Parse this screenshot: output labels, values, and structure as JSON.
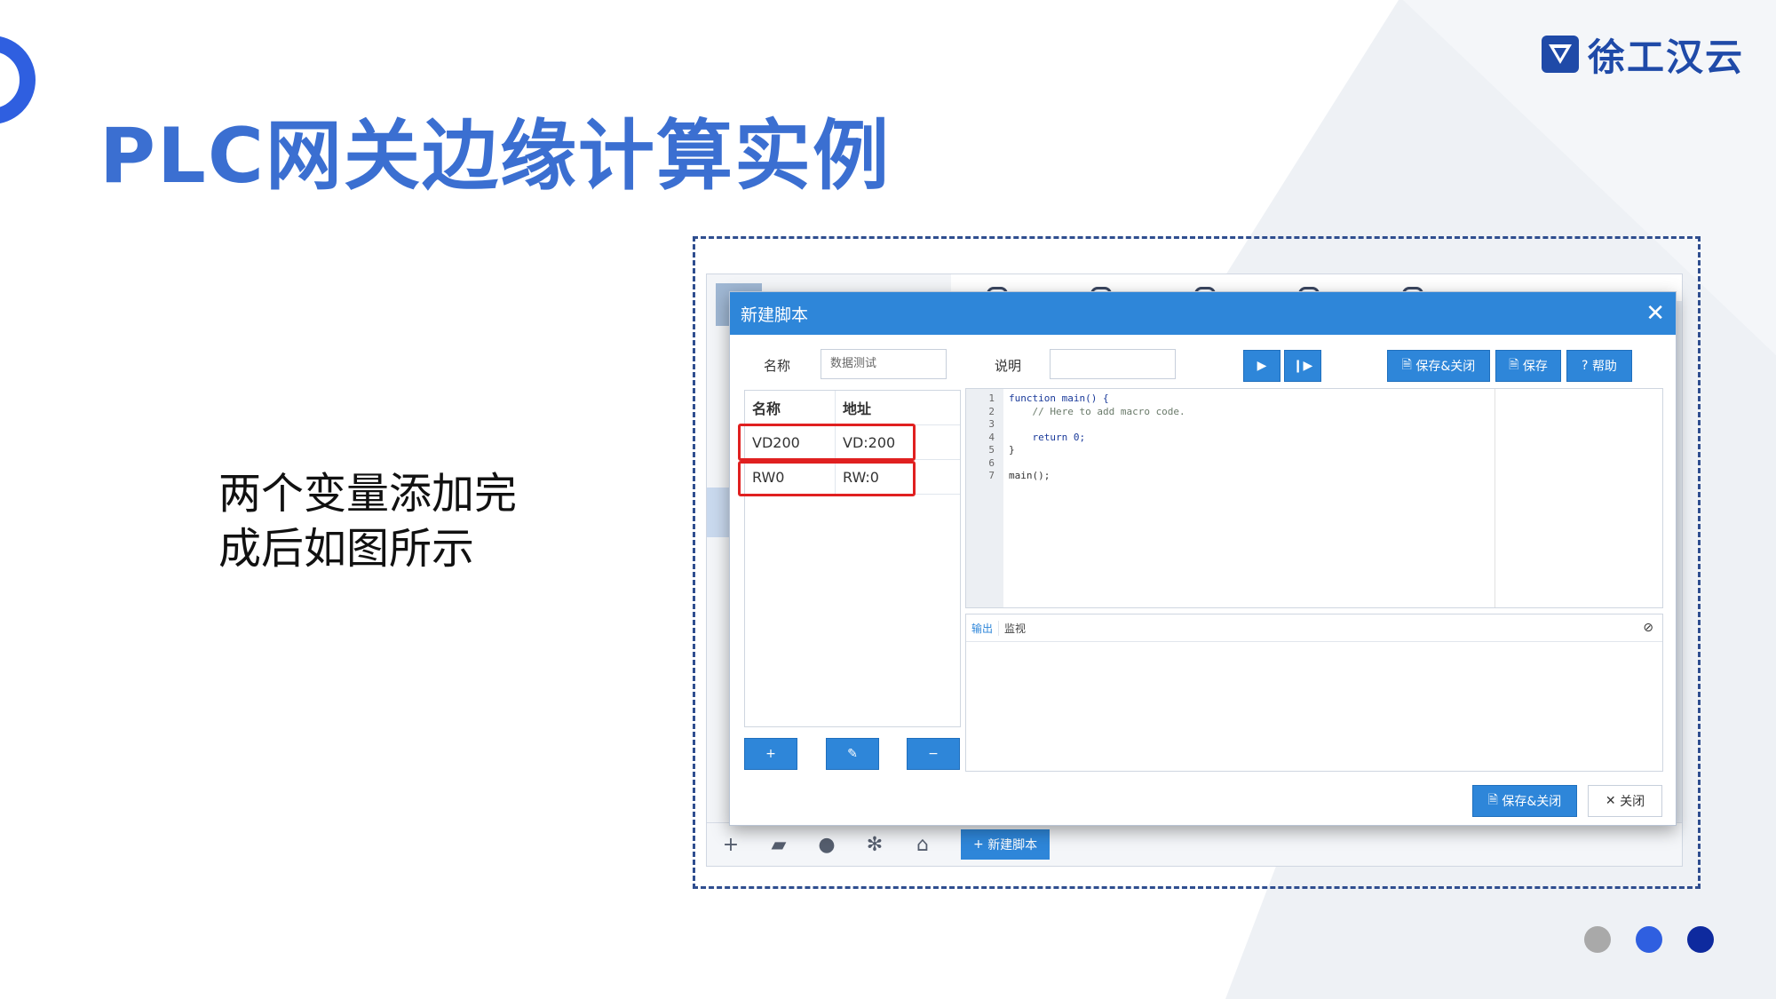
{
  "slide": {
    "title": "PLC网关边缘计算实例",
    "description_line1": "两个变量添加完",
    "description_line2": "成后如图所示",
    "logo_text": "徐工汉云",
    "dot_colors": [
      "#a9a9a9",
      "#2f5fe0",
      "#0e2a9e"
    ]
  },
  "colors": {
    "title": "#3b6fd1",
    "accent": "#2e86d9",
    "highlight": "#e02020"
  },
  "dialog": {
    "title": "新建脚本",
    "close_icon": "close-icon",
    "name_label": "名称",
    "name_value": "数据测试",
    "desc_label": "说明",
    "desc_value": "",
    "run_icon": "play-icon",
    "step_icon": "step-icon",
    "save_close_label": "保存&关闭",
    "save_label": "保存",
    "help_label": "帮助",
    "table": {
      "col_name": "名称",
      "col_addr": "地址",
      "rows": [
        {
          "name": "VD200",
          "addr": "VD:200"
        },
        {
          "name": "RW0",
          "addr": "RW:0"
        }
      ]
    },
    "add_icon": "plus-icon",
    "edit_icon": "edit-icon",
    "remove_icon": "minus-icon",
    "code_lines": [
      "function main() {",
      "    // Here to add macro code.",
      "",
      "    return 0;",
      "}",
      "",
      "main();"
    ],
    "line_numbers": [
      "1",
      "2",
      "3",
      "4",
      "5",
      "6",
      "7"
    ],
    "output_tab": "输出",
    "monitor_tab": "监视",
    "footer_save_close": "保存&关闭",
    "footer_close": "关闭"
  },
  "background_app": {
    "new_script_button": "新建脚本"
  }
}
